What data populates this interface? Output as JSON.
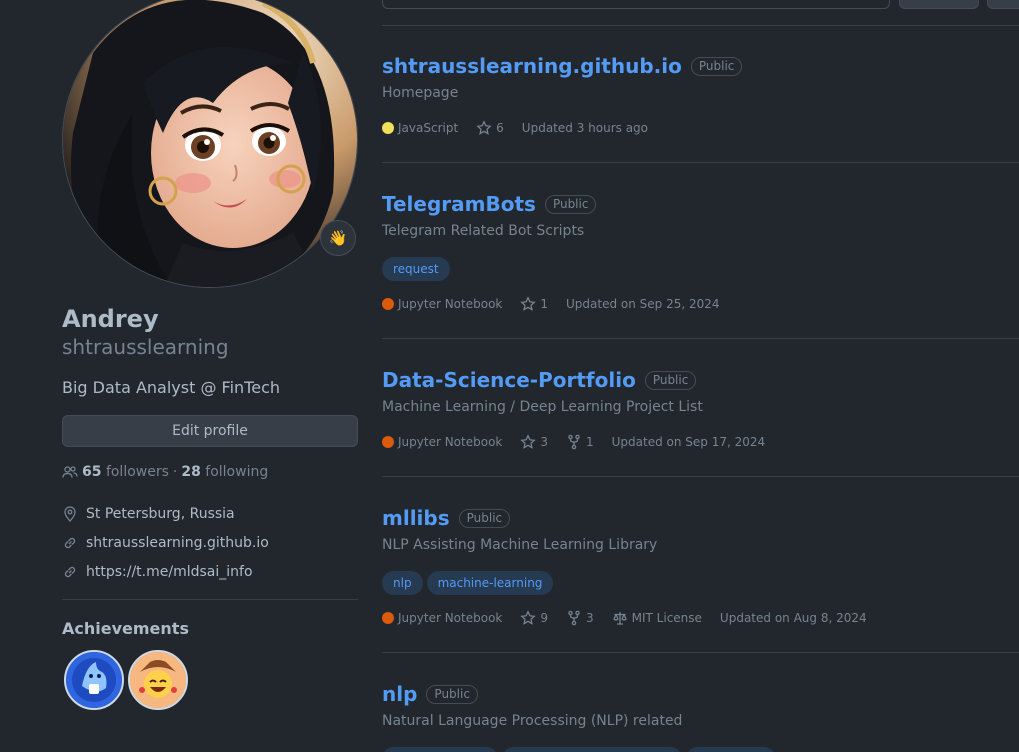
{
  "profile": {
    "name": "Andrey",
    "login": "shtrausslearning",
    "bio": "Big Data Analyst @ FinTech",
    "status_emoji": "👋",
    "edit_button": "Edit profile",
    "followers_count": "65",
    "followers_label": "followers",
    "separator": "·",
    "following_count": "28",
    "following_label": "following",
    "location": "St Petersburg, Russia",
    "website": "shtrausslearning.github.io",
    "social_link": "https://t.me/mldsai_info",
    "achievements_title": "Achievements"
  },
  "colors": {
    "link": "#539bf5",
    "javascript": "#f1e05a",
    "jupyter": "#DA5B0B",
    "background": "#22272e"
  },
  "repos": [
    {
      "name": "shtrausslearning.github.io",
      "visibility": "Public",
      "description": "Homepage",
      "topics": [],
      "language": "JavaScript",
      "language_color": "#f1e05a",
      "stars": "6",
      "forks": "",
      "license": "",
      "updated": "Updated 3 hours ago"
    },
    {
      "name": "TelegramBots",
      "visibility": "Public",
      "description": "Telegram Related Bot Scripts",
      "topics": [
        "request"
      ],
      "language": "Jupyter Notebook",
      "language_color": "#DA5B0B",
      "stars": "1",
      "forks": "",
      "license": "",
      "updated": "Updated on Sep 25, 2024"
    },
    {
      "name": "Data-Science-Portfolio",
      "visibility": "Public",
      "description": "Machine Learning / Deep Learning Project List",
      "topics": [],
      "language": "Jupyter Notebook",
      "language_color": "#DA5B0B",
      "stars": "3",
      "forks": "1",
      "license": "",
      "updated": "Updated on Sep 17, 2024"
    },
    {
      "name": "mllibs",
      "visibility": "Public",
      "description": "NLP Assisting Machine Learning Library",
      "topics": [
        "nlp",
        "machine-learning"
      ],
      "language": "Jupyter Notebook",
      "language_color": "#DA5B0B",
      "stars": "9",
      "forks": "3",
      "license": "MIT License",
      "updated": "Updated on Aug 8, 2024"
    },
    {
      "name": "nlp",
      "visibility": "Public",
      "description": "Natural Language Processing (NLP) related",
      "topics": [],
      "language": "",
      "language_color": "",
      "stars": "",
      "forks": "",
      "license": "",
      "updated": ""
    }
  ]
}
